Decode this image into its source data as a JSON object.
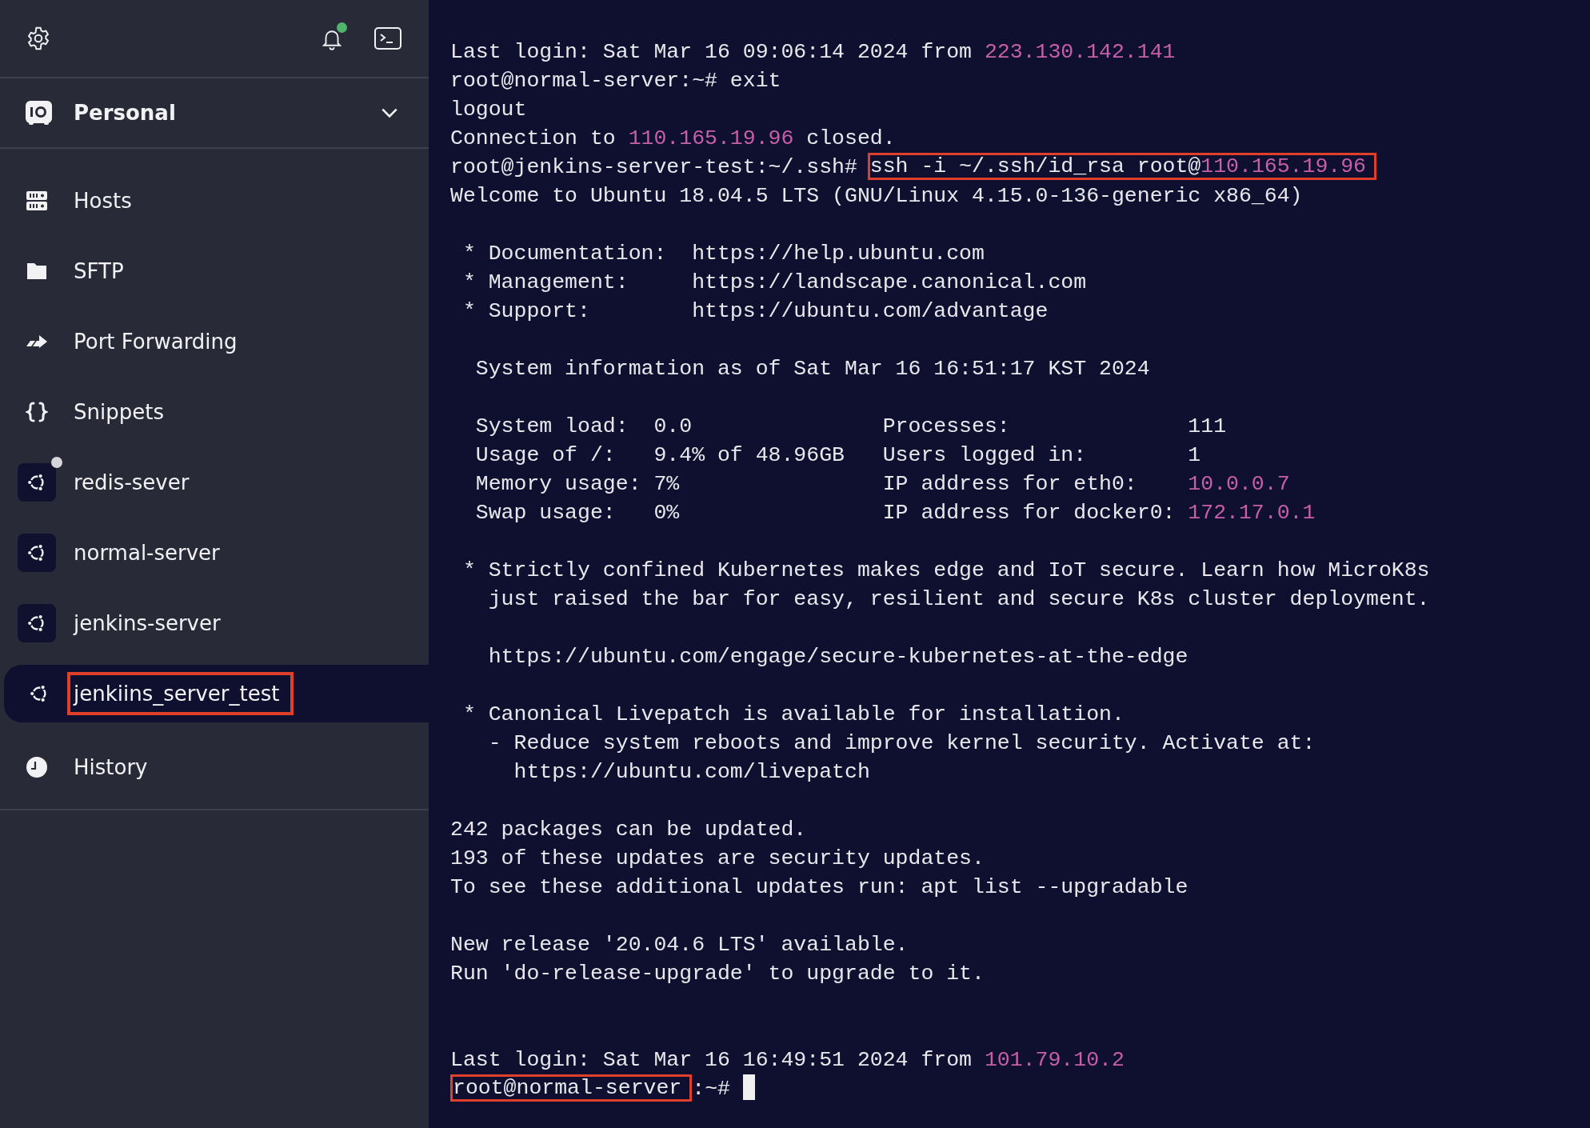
{
  "toolbar": {
    "notification_dot": true
  },
  "vault": {
    "name": "Personal"
  },
  "nav": [
    {
      "label": "Hosts",
      "kind": "hosts"
    },
    {
      "label": "SFTP",
      "kind": "sftp"
    },
    {
      "label": "Port Forwarding",
      "kind": "forwarding"
    },
    {
      "label": "Snippets",
      "kind": "snippets"
    }
  ],
  "hosts": [
    {
      "label": "redis-sever",
      "selected": false,
      "indicator": true,
      "annotated": false
    },
    {
      "label": "normal-server",
      "selected": false,
      "indicator": false,
      "annotated": false
    },
    {
      "label": "jenkins-server",
      "selected": false,
      "indicator": false,
      "annotated": false
    },
    {
      "label": "jenkiins_server_test",
      "selected": true,
      "indicator": false,
      "annotated": true
    }
  ],
  "history": {
    "label": "History"
  },
  "terminal": {
    "cursor": true,
    "blocks": [
      {
        "kind": "output",
        "lines": [
          [
            {
              "kind": "plain",
              "text": "Last login: Sat Mar 16 09:06:14 2024 from "
            },
            {
              "kind": "ip",
              "text": "223.130.142.141"
            }
          ],
          [
            {
              "kind": "plain",
              "text": "root@normal-server:~# exit"
            }
          ],
          [
            {
              "kind": "plain",
              "text": "logout"
            }
          ],
          [
            {
              "kind": "plain",
              "text": "Connection to "
            },
            {
              "kind": "ip",
              "text": "110.165.19.96"
            },
            {
              "kind": "plain",
              "text": " closed."
            }
          ],
          [
            {
              "kind": "plain",
              "text": "root@jenkins-server-test:~/.ssh# "
            },
            {
              "kind": "boxed",
              "parts": [
                {
                  "kind": "plain",
                  "text": "ssh -i ~/.ssh/id_rsa root@"
                },
                {
                  "kind": "ip",
                  "text": "110.165.19.96"
                }
              ]
            }
          ],
          [
            {
              "kind": "plain",
              "text": "Welcome to Ubuntu 18.04.5 LTS (GNU/Linux 4.15.0-136-generic x86_64)"
            }
          ]
        ]
      },
      {
        "kind": "output",
        "lines": [
          [
            {
              "kind": "plain",
              "text": " * Documentation:  https://help.ubuntu.com"
            }
          ],
          [
            {
              "kind": "plain",
              "text": " * Management:     https://landscape.canonical.com"
            }
          ],
          [
            {
              "kind": "plain",
              "text": " * Support:        https://ubuntu.com/advantage"
            }
          ]
        ]
      },
      {
        "kind": "output",
        "lines": [
          [
            {
              "kind": "plain",
              "text": "  System information as of Sat Mar 16 16:51:17 KST 2024"
            }
          ]
        ]
      },
      {
        "kind": "output",
        "lines": [
          [
            {
              "kind": "plain",
              "text": "  System load:  0.0               Processes:              111"
            }
          ],
          [
            {
              "kind": "plain",
              "text": "  Usage of /:   9.4% of 48.96GB   Users logged in:        1"
            }
          ],
          [
            {
              "kind": "plain",
              "text": "  Memory usage: 7%                IP address for eth0:    "
            },
            {
              "kind": "ip",
              "text": "10.0.0.7"
            }
          ],
          [
            {
              "kind": "plain",
              "text": "  Swap usage:   0%                IP address for docker0: "
            },
            {
              "kind": "ip",
              "text": "172.17.0.1"
            }
          ]
        ]
      },
      {
        "kind": "output",
        "lines": [
          [
            {
              "kind": "plain",
              "text": " * Strictly confined Kubernetes makes edge and IoT secure. Learn how MicroK8s"
            }
          ],
          [
            {
              "kind": "plain",
              "text": "   just raised the bar for easy, resilient and secure K8s cluster deployment."
            }
          ]
        ]
      },
      {
        "kind": "output",
        "lines": [
          [
            {
              "kind": "plain",
              "text": "   https://ubuntu.com/engage/secure-kubernetes-at-the-edge"
            }
          ]
        ]
      },
      {
        "kind": "output",
        "lines": [
          [
            {
              "kind": "plain",
              "text": " * Canonical Livepatch is available for installation."
            }
          ],
          [
            {
              "kind": "plain",
              "text": "   - Reduce system reboots and improve kernel security. Activate at:"
            }
          ],
          [
            {
              "kind": "plain",
              "text": "     https://ubuntu.com/livepatch"
            }
          ]
        ]
      },
      {
        "kind": "output",
        "lines": [
          [
            {
              "kind": "plain",
              "text": "242 packages can be updated."
            }
          ],
          [
            {
              "kind": "plain",
              "text": "193 of these updates are security updates."
            }
          ],
          [
            {
              "kind": "plain",
              "text": "To see these additional updates run: apt list --upgradable"
            }
          ]
        ]
      },
      {
        "kind": "output",
        "lines": [
          [
            {
              "kind": "plain",
              "text": "New release '20.04.6 LTS' available."
            }
          ],
          [
            {
              "kind": "plain",
              "text": "Run 'do-release-upgrade' to upgrade to it."
            }
          ]
        ]
      },
      {
        "kind": "session",
        "lines": [
          [
            {
              "kind": "plain",
              "text": "Last login: Sat Mar 16 16:49:51 2024 from "
            },
            {
              "kind": "ip",
              "text": "101.79.10.2"
            }
          ],
          [
            {
              "kind": "boxed",
              "parts": [
                {
                  "kind": "plain",
                  "text": "root@normal-server"
                }
              ]
            },
            {
              "kind": "plain",
              "text": ":~# "
            }
          ]
        ]
      }
    ]
  }
}
